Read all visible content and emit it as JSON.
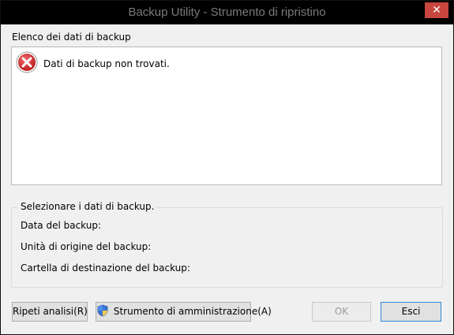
{
  "window": {
    "title": "Backup Utility - Strumento di ripristino",
    "close_label": "✕"
  },
  "list": {
    "label": "Elenco dei dati di backup",
    "items": [
      {
        "text": "Dati di backup non trovati.",
        "icon": "error-icon"
      }
    ]
  },
  "details": {
    "title": "Selezionare i dati di backup.",
    "date_label": "Data del backup:",
    "source_label": "Unità di origine del backup:",
    "destination_label": "Cartella di destinazione del backup:"
  },
  "buttons": {
    "rescan": "Ripeti analisi(R)",
    "admin_tool": "Strumento di amministrazione(A)",
    "ok": "OK",
    "exit": "Esci"
  },
  "colors": {
    "close_button": "#c7463e",
    "error_icon": "#d8282a",
    "default_button_border": "#2f88d6"
  }
}
